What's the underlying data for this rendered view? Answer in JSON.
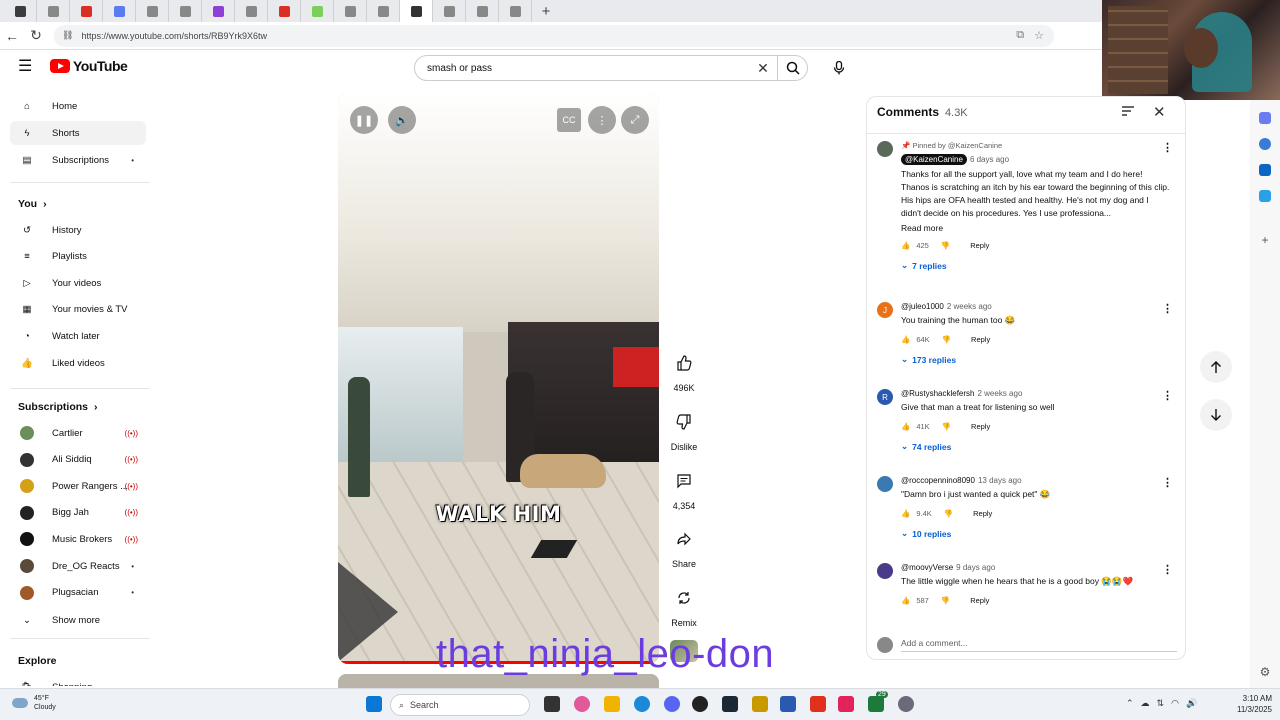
{
  "browser": {
    "url": "https://www.youtube.com/shorts/RB9Yrk9X6tw",
    "new_tab_label": "+",
    "tab_icons": [
      "#3c3c3c",
      "#888",
      "#d93025",
      "#5b7cf0",
      "#888",
      "#888",
      "#8e3fd6",
      "#888",
      "#d93025",
      "#7bd05b",
      "#888",
      "#888",
      "#333",
      "#888",
      "#888",
      "#888"
    ]
  },
  "header": {
    "logo_text": "YouTube",
    "search_value": "smash or pass"
  },
  "sidebar": {
    "top_items": [
      {
        "label": "Home",
        "icon": "home-icon"
      },
      {
        "label": "Shorts",
        "icon": "shorts-icon"
      },
      {
        "label": "Subscriptions",
        "icon": "subscriptions-icon"
      }
    ],
    "you_heading": "You",
    "you_items": [
      {
        "label": "History",
        "icon": "history-icon"
      },
      {
        "label": "Playlists",
        "icon": "playlists-icon"
      },
      {
        "label": "Your videos",
        "icon": "your-videos-icon"
      },
      {
        "label": "Your movies & TV",
        "icon": "movies-icon"
      },
      {
        "label": "Watch later",
        "icon": "watch-later-icon"
      },
      {
        "label": "Liked videos",
        "icon": "liked-icon"
      }
    ],
    "subs_heading": "Subscriptions",
    "subscriptions": [
      {
        "label": "Cartlier",
        "color": "#6b8e5a",
        "status": "live"
      },
      {
        "label": "Ali Siddiq",
        "color": "#333333",
        "status": "live"
      },
      {
        "label": "Power Rangers ...",
        "color": "#d4a017",
        "status": "live"
      },
      {
        "label": "Bigg Jah",
        "color": "#222222",
        "status": "live"
      },
      {
        "label": "Music Brokers",
        "color": "#111111",
        "status": "live"
      },
      {
        "label": "Dre_OG Reacts",
        "color": "#5a4a3a",
        "status": "dot"
      },
      {
        "label": "Plugsacian",
        "color": "#a05a2a",
        "status": "dot"
      }
    ],
    "show_more": "Show more",
    "explore_heading": "Explore",
    "explore_first": "Shopping"
  },
  "video": {
    "caption": "WALK HIM",
    "progress": 0.98,
    "watermark": "that_ninja_leo-don"
  },
  "actions": {
    "like_count": "496K",
    "dislike_label": "Dislike",
    "comment_count": "4,354",
    "share_label": "Share",
    "remix_label": "Remix"
  },
  "comments": {
    "title": "Comments",
    "count": "4.3K",
    "pinned_by": "Pinned by @KaizenCanine",
    "add_placeholder": "Add a comment...",
    "items": [
      {
        "author": "@KaizenCanine",
        "age": "6 days ago",
        "text": "Thanks for all the support yall, love what my team and I do here! Thanos is scratching an itch by his ear toward the beginning of this clip. His hips are OFA health tested and healthy. He's not my dog and I didn't decide on his procedures. Yes I use professiona...",
        "read_more": "Read more",
        "likes": "425",
        "reply_label": "Reply",
        "replies": "7 replies",
        "avatar_color": "#5a6a5a",
        "avatar_letter": ""
      },
      {
        "author": "@juleo1000",
        "age": "2 weeks ago",
        "text": "You training the human too 😂",
        "likes": "64K",
        "reply_label": "Reply",
        "replies": "173 replies",
        "avatar_color": "#e8711a",
        "avatar_letter": "J"
      },
      {
        "author": "@Rustyshacklefersh",
        "age": "2 weeks ago",
        "text": "Give that man a treat for listening so well",
        "likes": "41K",
        "reply_label": "Reply",
        "replies": "74 replies",
        "avatar_color": "#2a5ab0",
        "avatar_letter": "R"
      },
      {
        "author": "@roccopennino8090",
        "age": "13 days ago",
        "text": "\"Damn bro i just wanted a quick pet\" 😂",
        "likes": "9.4K",
        "reply_label": "Reply",
        "replies": "10 replies",
        "avatar_color": "#3a7ab0",
        "avatar_letter": ""
      },
      {
        "author": "@moovyVerse",
        "age": "9 days ago",
        "text": "The little wiggle when he hears that he is a good boy 😭😭❤️",
        "likes": "587",
        "reply_label": "Reply",
        "avatar_color": "#4a3a8a",
        "avatar_letter": ""
      }
    ]
  },
  "taskbar": {
    "temperature": "45°F",
    "condition": "Cloudy",
    "search_label": "Search",
    "time": "3:10 AM",
    "date": "11/3/2025",
    "badge": "29"
  }
}
